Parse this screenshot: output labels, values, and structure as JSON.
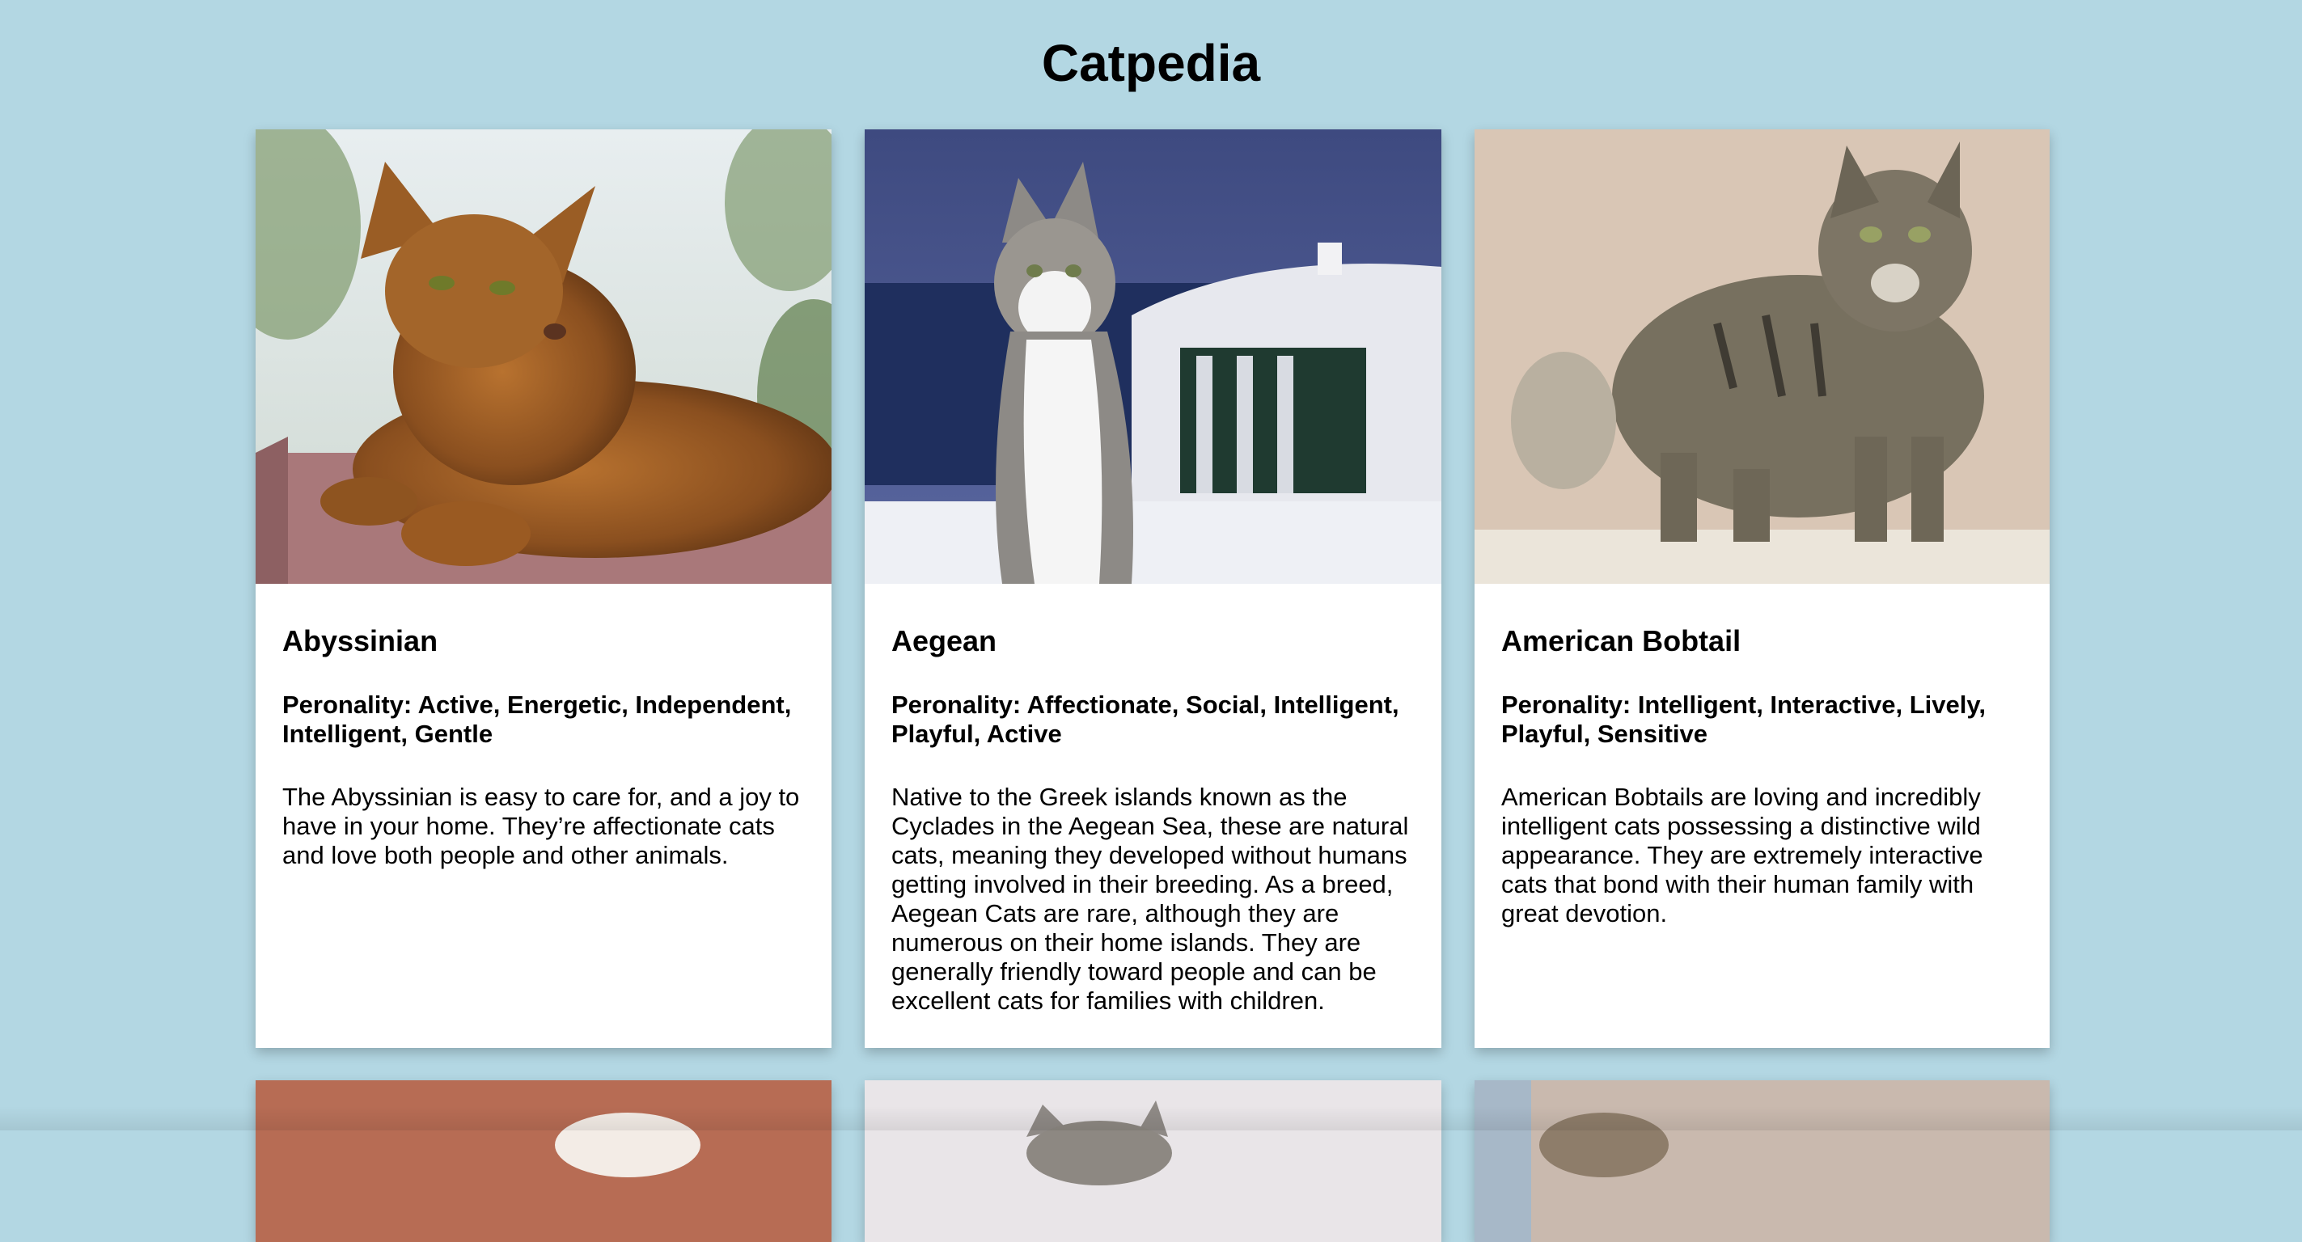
{
  "page": {
    "title": "Catpedia",
    "background": "#b3d7e3"
  },
  "cards": [
    {
      "name": "Abyssinian",
      "personality": "Peronality: Active, Energetic, Independent, Intelligent, Gentle",
      "description": "The Abyssinian is easy to care for, and a joy to have in your home. They’re affectionate cats and love both people and other animals.",
      "image": "abyssinian-cat-photo"
    },
    {
      "name": "Aegean",
      "personality": "Peronality: Affectionate, Social, Intelligent, Playful, Active",
      "description": "Native to the Greek islands known as the Cyclades in the Aegean Sea, these are natural cats, meaning they developed without humans getting involved in their breeding. As a breed, Aegean Cats are rare, although they are numerous on their home islands. They are generally friendly toward people and can be excellent cats for families with children.",
      "image": "aegean-cat-photo"
    },
    {
      "name": "American Bobtail",
      "personality": "Peronality: Intelligent, Interactive, Lively, Playful, Sensitive",
      "description": "American Bobtails are loving and incredibly intelligent cats possessing a distinctive wild appearance. They are extremely interactive cats that bond with their human family with great devotion.",
      "image": "american-bobtail-cat-photo"
    }
  ]
}
